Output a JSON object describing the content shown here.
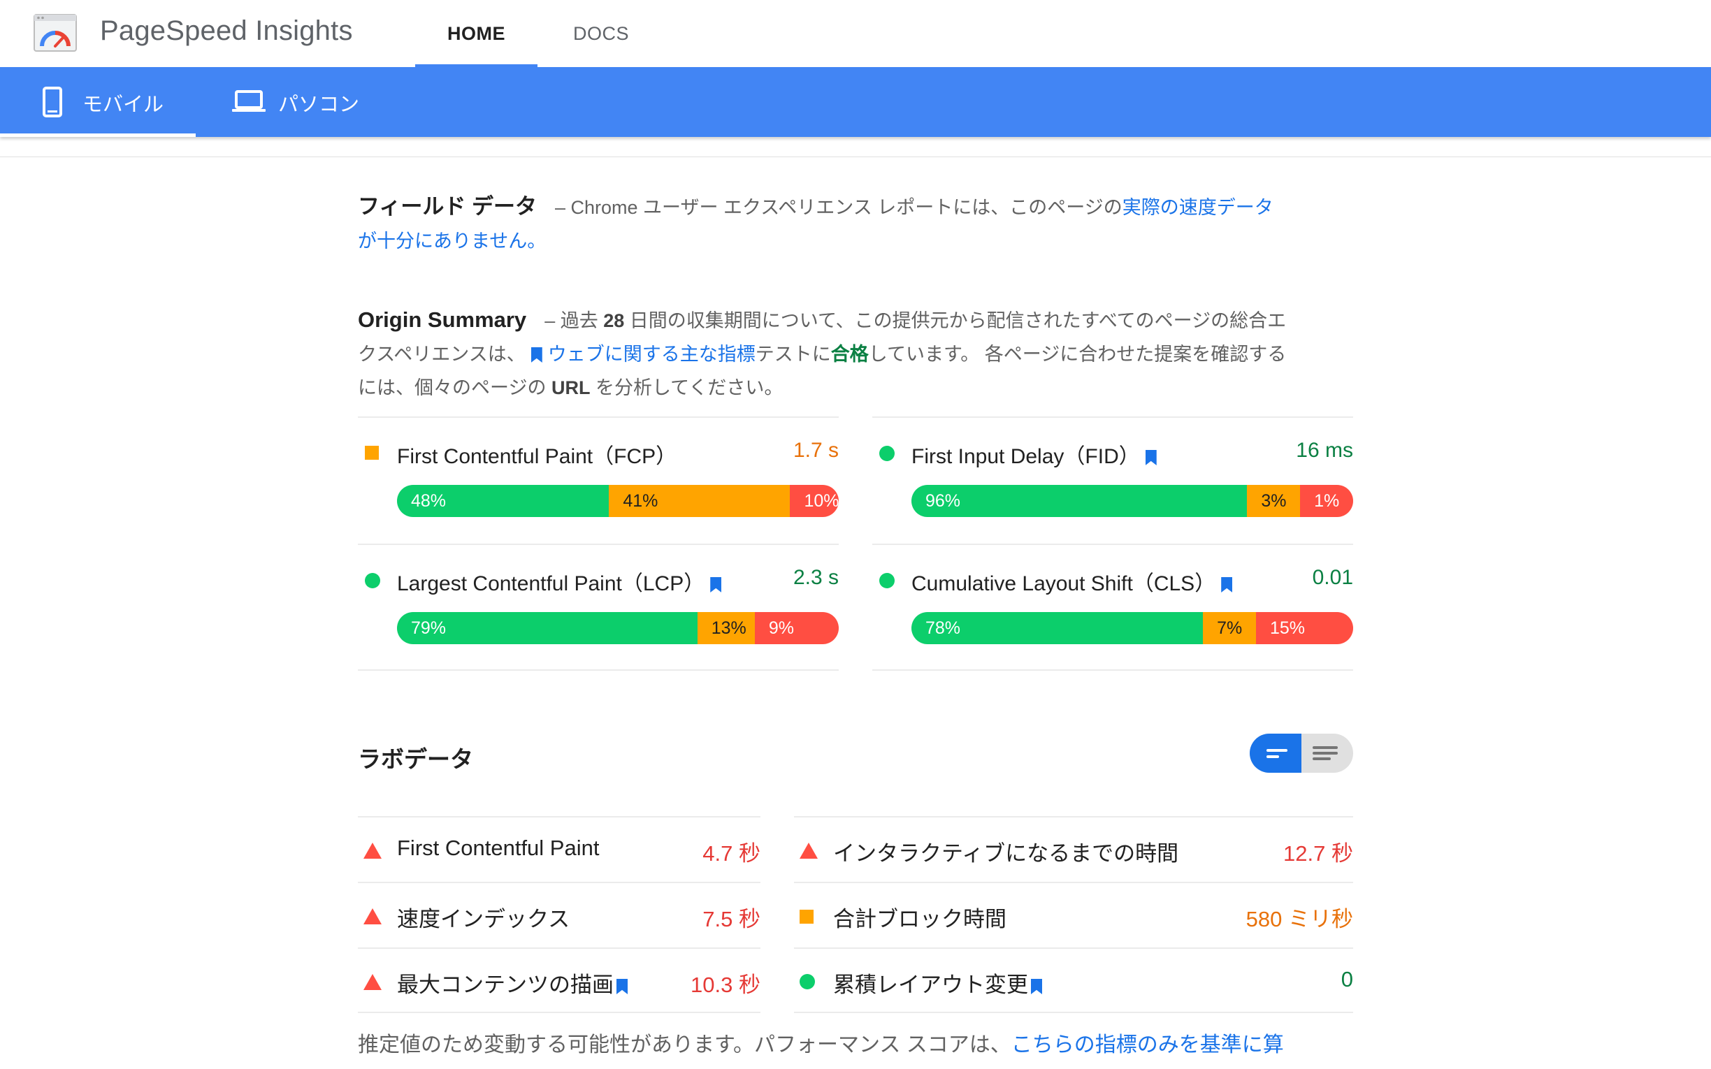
{
  "header": {
    "title": "PageSpeed Insights",
    "tabs": {
      "home": "HOME",
      "docs": "DOCS"
    }
  },
  "devices": {
    "mobile": "モバイル",
    "desktop": "パソコン"
  },
  "field_data": {
    "heading": "フィールド データ",
    "text_a": "– Chrome ユーザー エクスペリエンス レポートには、このページの",
    "link": "実際の速度データが十分にありません。"
  },
  "origin": {
    "heading": "Origin Summary",
    "text_a": "– 過去 ",
    "days": "28",
    "text_b": " 日間の収集期間について、この提供元から配信されたすべてのページの総合エクスペリエンスは、",
    "link": "ウェブに関する主な指標",
    "text_c": "テストに",
    "pass": "合格",
    "text_d": "しています。 各ページに合わせた提案を確認するには、個々のページの ",
    "url": "URL",
    "text_e": " を分析してください。"
  },
  "field_metrics": [
    {
      "name": "First Contentful Paint（FCP）",
      "value": "1.7 s",
      "status": "average",
      "bookmark": false,
      "dist": [
        {
          "label": "48%",
          "pct": 48
        },
        {
          "label": "41%",
          "pct": 41
        },
        {
          "label": "10%",
          "pct": 11
        }
      ]
    },
    {
      "name": "First Input Delay（FID）",
      "value": "16 ms",
      "status": "good",
      "bookmark": true,
      "dist": [
        {
          "label": "96%",
          "pct": 76
        },
        {
          "label": "3%",
          "pct": 12
        },
        {
          "label": "1%",
          "pct": 12
        }
      ]
    },
    {
      "name": "Largest Contentful Paint（LCP）",
      "value": "2.3 s",
      "status": "good",
      "bookmark": true,
      "dist": [
        {
          "label": "79%",
          "pct": 68
        },
        {
          "label": "13%",
          "pct": 13
        },
        {
          "label": "9%",
          "pct": 19
        }
      ]
    },
    {
      "name": "Cumulative Layout Shift（CLS）",
      "value": "0.01",
      "status": "good",
      "bookmark": true,
      "dist": [
        {
          "label": "78%",
          "pct": 66
        },
        {
          "label": "7%",
          "pct": 12
        },
        {
          "label": "15%",
          "pct": 22
        }
      ]
    }
  ],
  "lab": {
    "title": "ラボデータ",
    "metrics": [
      {
        "name": "First Contentful Paint",
        "value": "4.7 秒",
        "status": "poor",
        "bookmark": false
      },
      {
        "name": "インタラクティブになるまでの時間",
        "value": "12.7 秒",
        "status": "poor",
        "bookmark": false
      },
      {
        "name": "速度インデックス",
        "value": "7.5 秒",
        "status": "poor",
        "bookmark": false
      },
      {
        "name": "合計ブロック時間",
        "value": "580 ミリ秒",
        "status": "average",
        "bookmark": false
      },
      {
        "name": "最大コンテンツの描画",
        "value": "10.3 秒",
        "status": "poor",
        "bookmark": true
      },
      {
        "name": "累積レイアウト変更",
        "value": "0",
        "status": "good",
        "bookmark": true
      }
    ],
    "footnote_a": "推定値のため変動する可能性があります。パフォーマンス スコアは、",
    "footnote_link": "こちらの指標のみを基準に算"
  },
  "colors": {
    "accent": "#4285f4",
    "good": "#0cce6b",
    "average": "#ffa400",
    "poor": "#ff4e42",
    "link": "#1a73e8"
  }
}
